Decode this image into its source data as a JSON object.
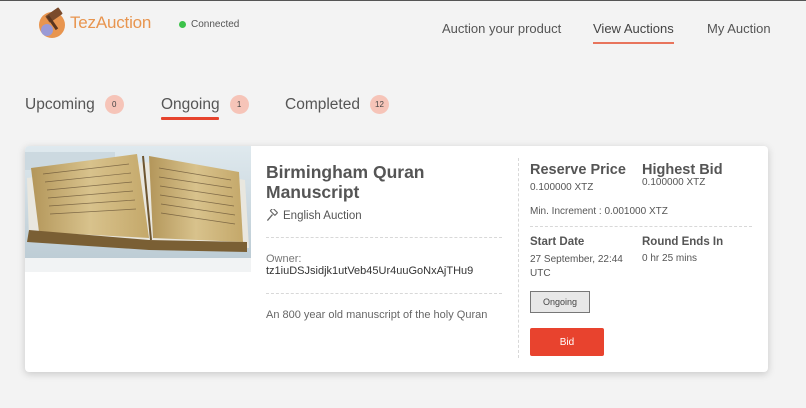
{
  "brand": {
    "name": "TezAuction",
    "accent": "#e8954f"
  },
  "connection": {
    "status": "Connected",
    "color": "#3cc24a"
  },
  "nav": {
    "items": [
      {
        "label": "Auction your product"
      },
      {
        "label": "View Auctions",
        "active": true
      },
      {
        "label": "My Auction"
      }
    ]
  },
  "tabs": [
    {
      "label": "Upcoming",
      "count": "0"
    },
    {
      "label": "Ongoing",
      "count": "1",
      "active": true
    },
    {
      "label": "Completed",
      "count": "12"
    }
  ],
  "auction": {
    "image_icon": "manuscript-photo",
    "title": "Birmingham Quran Manuscript",
    "type_icon": "hammer-icon",
    "type": "English Auction",
    "owner_label": "Owner:",
    "owner": "tz1iuDSJsidjk1utVeb45Ur4uuGoNxAjTHu9",
    "description": "An 800 year old manuscript of the holy Quran",
    "reserve_price_label": "Reserve Price",
    "reserve_price": "0.100000 XTZ",
    "highest_bid_label": "Highest Bid",
    "highest_bid": "0.100000 XTZ",
    "min_increment": "Min. Increment : 0.001000 XTZ",
    "start_date_label": "Start Date",
    "start_date": "27 September, 22:44 UTC",
    "round_ends_label": "Round Ends In",
    "round_ends": "0 hr 25 mins",
    "status": "Ongoing",
    "bid_label": "Bid",
    "bid_color": "#e8432e"
  }
}
